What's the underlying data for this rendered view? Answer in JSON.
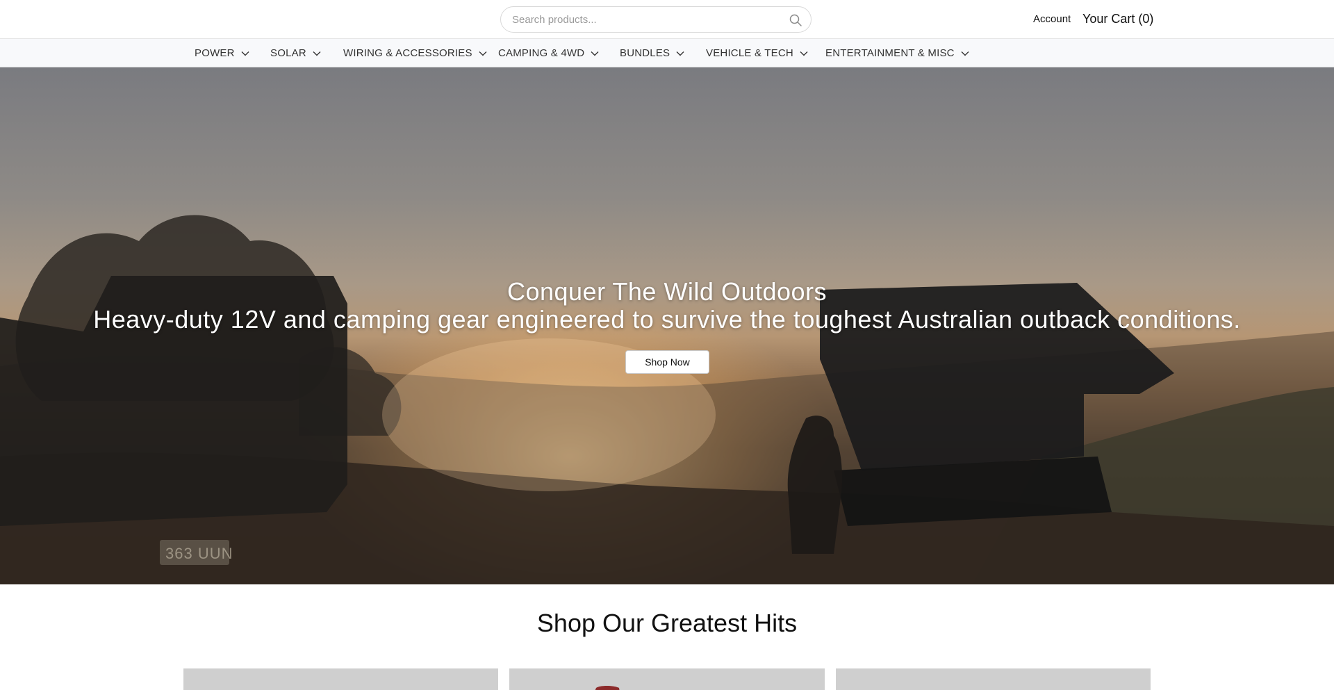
{
  "header": {
    "search_placeholder": "Search products...",
    "account_label": "Account",
    "cart_label": "Your Cart (0)"
  },
  "nav": {
    "items": [
      {
        "label": "POWER"
      },
      {
        "label": "SOLAR"
      },
      {
        "label": "WIRING & ACCESSORIES"
      },
      {
        "label": "CAMPING & 4WD"
      },
      {
        "label": "BUNDLES"
      },
      {
        "label": "VEHICLE & TECH"
      },
      {
        "label": "ENTERTAINMENT & MISC"
      }
    ]
  },
  "hero": {
    "title": "Conquer The Wild Outdoors",
    "subtitle": "Heavy-duty 12V and camping gear engineered to survive the toughest Australian outback conditions.",
    "cta_label": "Shop Now",
    "plate_text": "363 UUN"
  },
  "greatest_hits": {
    "title": "Shop Our Greatest Hits",
    "cards": [
      {},
      {},
      {}
    ]
  },
  "colors": {
    "nav_bg": "#f8f9fb",
    "card_placeholder": "#cfcfcf",
    "hero_glow": "#ffd696"
  },
  "icons": {
    "search": "search-icon",
    "chevron": "chevron-down-icon"
  }
}
